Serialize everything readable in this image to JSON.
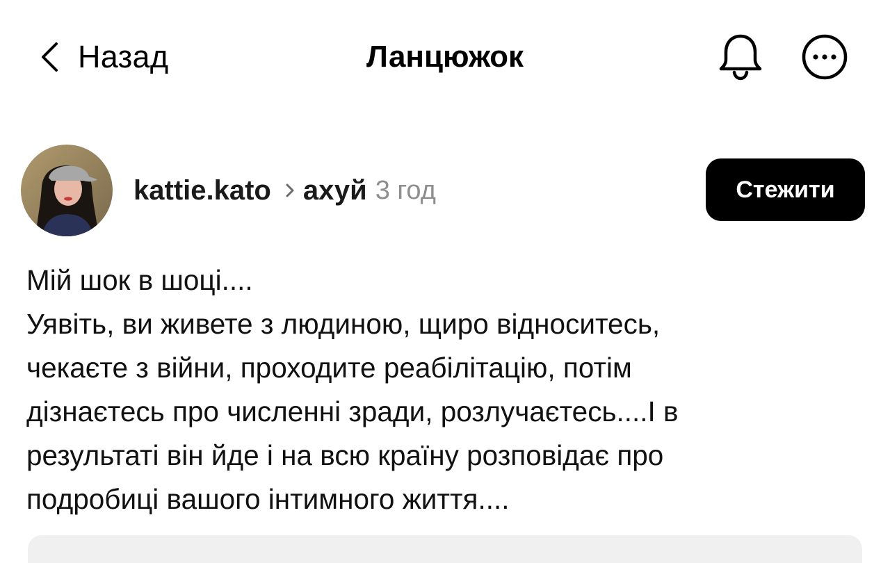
{
  "nav": {
    "back_label": "Назад",
    "title": "Ланцюжок",
    "icons": [
      "chevron-left-icon",
      "bell-icon",
      "more-icon"
    ]
  },
  "post": {
    "author": {
      "username": "kattie.kato",
      "avatar": "avatar"
    },
    "topic": "ахуй",
    "time": "3 год",
    "follow_label": "Стежити",
    "lines": [
      "Мій шок в шоці....",
      "Уявіть, ви живете з людиною, щиро відноситесь,",
      "чекаєте з війни, проходите реабілітацію, потім",
      "дізнаєтесь про численні зради, розлучаєтесь....І в",
      "результаті він йде і на всю країну розповідає про",
      "подробиці вашого інтимного життя...."
    ]
  },
  "colors": {
    "accent": "#000000",
    "text": "#111111",
    "muted": "#8e8e8e",
    "background": "#ffffff"
  }
}
